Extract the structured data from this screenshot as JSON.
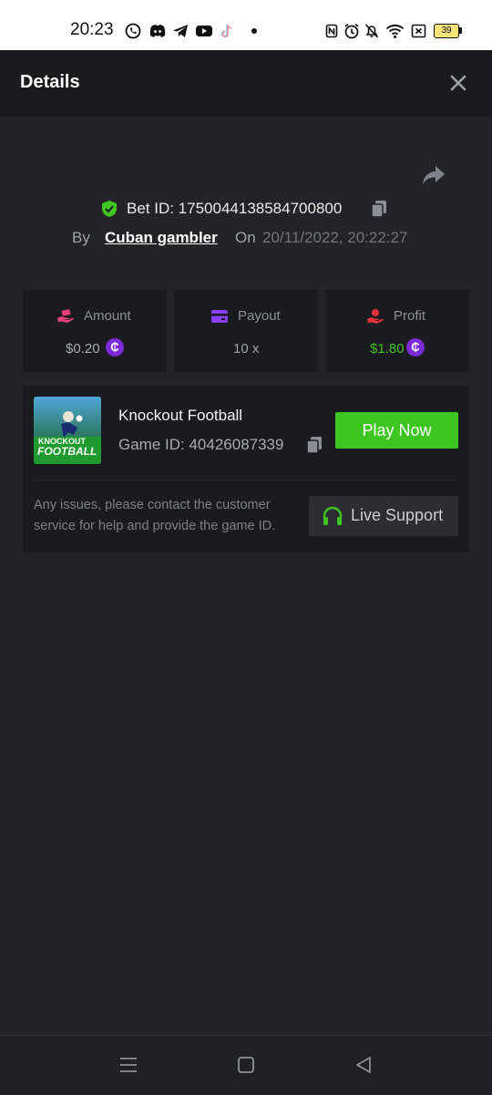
{
  "status_bar": {
    "time": "20:23",
    "battery": "39",
    "icons": [
      "whatsapp-icon",
      "discord-icon",
      "telegram-icon",
      "youtube-icon",
      "tiktok-icon",
      "dot-icon",
      "nfc-icon",
      "alarm-icon",
      "bell-off-icon",
      "wifi-icon",
      "close-box-icon",
      "battery-icon"
    ]
  },
  "header": {
    "title": "Details"
  },
  "bet": {
    "id_text": "Bet ID: 1750044138584700800",
    "by_label": "By",
    "user": "Cuban gambler",
    "on_label": "On",
    "date": "20/11/2022, 20:22:27"
  },
  "stats": {
    "amount_label": "Amount",
    "amount_value": "$0.20",
    "payout_label": "Payout",
    "payout_value": "10 x",
    "profit_label": "Profit",
    "profit_value": "$1.80",
    "coin_symbol": "₵",
    "colors": {
      "amount_icon": "#e8407a",
      "payout_icon": "#8b3dff",
      "profit_icon": "#e0303a",
      "profit_value": "#3ec521",
      "coin": "#7a2ad6"
    }
  },
  "game": {
    "name": "Knockout Football",
    "id_text": "Game ID: 40426087339",
    "play_label": "Play Now",
    "thumb_text_top": "KNOCKOUT",
    "thumb_text_bottom": "FOOTBALL",
    "issue_text": "Any issues, please contact the customer service for help and provide the game ID.",
    "support_label": "Live Support",
    "play_color": "#3ec521"
  },
  "nav": {
    "icons": [
      "menu-icon",
      "home-square-icon",
      "back-triangle-icon"
    ]
  }
}
